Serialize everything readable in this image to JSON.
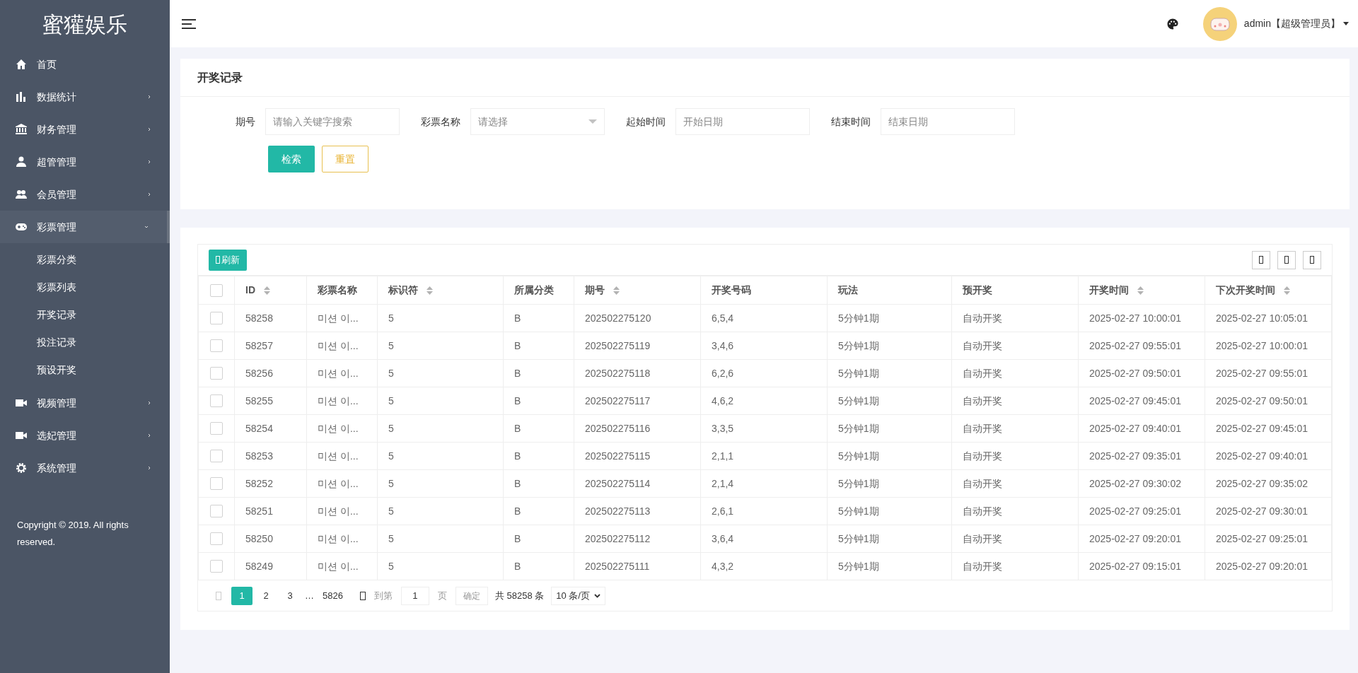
{
  "sidebar": {
    "logo": "蜜獾娱乐",
    "items": [
      {
        "label": "首页",
        "kind": "link",
        "expanded": false
      },
      {
        "label": "数据统计",
        "kind": "menu",
        "expanded": false
      },
      {
        "label": "财务管理",
        "kind": "menu",
        "expanded": false
      },
      {
        "label": "超管管理",
        "kind": "menu",
        "expanded": false
      },
      {
        "label": "会员管理",
        "kind": "menu",
        "expanded": false
      },
      {
        "label": "彩票管理",
        "kind": "menu",
        "expanded": true,
        "children": [
          {
            "label": "彩票分类"
          },
          {
            "label": "彩票列表"
          },
          {
            "label": "开奖记录"
          },
          {
            "label": "投注记录"
          },
          {
            "label": "预设开奖"
          }
        ]
      },
      {
        "label": "视频管理",
        "kind": "menu",
        "expanded": false
      },
      {
        "label": "选妃管理",
        "kind": "menu",
        "expanded": false
      },
      {
        "label": "系统管理",
        "kind": "menu",
        "expanded": false
      }
    ],
    "copyright": "Copyright © 2019. All rights reserved."
  },
  "header": {
    "user": "admin【超级管理员】"
  },
  "filter": {
    "title": "开奖记录",
    "fields": [
      {
        "label": "期号",
        "kind": "text",
        "placeholder": "请输入关键字搜索"
      },
      {
        "label": "彩票名称",
        "kind": "select",
        "placeholder": "请选择"
      },
      {
        "label": "起始时间",
        "kind": "text",
        "placeholder": "开始日期"
      },
      {
        "label": "结束时间",
        "kind": "text",
        "placeholder": "结束日期"
      }
    ],
    "buttons": [
      {
        "label": "检索",
        "kind": "primary"
      },
      {
        "label": "重置",
        "kind": "outline"
      }
    ]
  },
  "table": {
    "refresh": "刷新",
    "select_all_checked": false,
    "columns": [
      {
        "label": "ID",
        "sortable": true
      },
      {
        "label": "彩票名称",
        "sortable": false
      },
      {
        "label": "标识符",
        "sortable": true
      },
      {
        "label": "所属分类",
        "sortable": false
      },
      {
        "label": "期号",
        "sortable": true
      },
      {
        "label": "开奖号码",
        "sortable": false
      },
      {
        "label": "玩法",
        "sortable": false
      },
      {
        "label": "预开奖",
        "sortable": false
      },
      {
        "label": "开奖时间",
        "sortable": true
      },
      {
        "label": "下次开奖时间",
        "sortable": true
      }
    ],
    "rows": [
      {
        "checked": false,
        "cells": [
          "58258",
          "미션 이...",
          "5",
          "B",
          "202502275120",
          "6,5,4",
          "5分钟1期",
          "自动开奖",
          "2025-02-27 10:00:01",
          "2025-02-27 10:05:01"
        ]
      },
      {
        "checked": false,
        "cells": [
          "58257",
          "미션 이...",
          "5",
          "B",
          "202502275119",
          "3,4,6",
          "5分钟1期",
          "自动开奖",
          "2025-02-27 09:55:01",
          "2025-02-27 10:00:01"
        ]
      },
      {
        "checked": false,
        "cells": [
          "58256",
          "미션 이...",
          "5",
          "B",
          "202502275118",
          "6,2,6",
          "5分钟1期",
          "自动开奖",
          "2025-02-27 09:50:01",
          "2025-02-27 09:55:01"
        ]
      },
      {
        "checked": false,
        "cells": [
          "58255",
          "미션 이...",
          "5",
          "B",
          "202502275117",
          "4,6,2",
          "5分钟1期",
          "自动开奖",
          "2025-02-27 09:45:01",
          "2025-02-27 09:50:01"
        ]
      },
      {
        "checked": false,
        "cells": [
          "58254",
          "미션 이...",
          "5",
          "B",
          "202502275116",
          "3,3,5",
          "5分钟1期",
          "自动开奖",
          "2025-02-27 09:40:01",
          "2025-02-27 09:45:01"
        ]
      },
      {
        "checked": false,
        "cells": [
          "58253",
          "미션 이...",
          "5",
          "B",
          "202502275115",
          "2,1,1",
          "5分钟1期",
          "自动开奖",
          "2025-02-27 09:35:01",
          "2025-02-27 09:40:01"
        ]
      },
      {
        "checked": false,
        "cells": [
          "58252",
          "미션 이...",
          "5",
          "B",
          "202502275114",
          "2,1,4",
          "5分钟1期",
          "自动开奖",
          "2025-02-27 09:30:02",
          "2025-02-27 09:35:02"
        ]
      },
      {
        "checked": false,
        "cells": [
          "58251",
          "미션 이...",
          "5",
          "B",
          "202502275113",
          "2,6,1",
          "5分钟1期",
          "自动开奖",
          "2025-02-27 09:25:01",
          "2025-02-27 09:30:01"
        ]
      },
      {
        "checked": false,
        "cells": [
          "58250",
          "미션 이...",
          "5",
          "B",
          "202502275112",
          "3,6,4",
          "5分钟1期",
          "自动开奖",
          "2025-02-27 09:20:01",
          "2025-02-27 09:25:01"
        ]
      },
      {
        "checked": false,
        "cells": [
          "58249",
          "미션 이...",
          "5",
          "B",
          "202502275111",
          "4,3,2",
          "5分钟1期",
          "自动开奖",
          "2025-02-27 09:15:01",
          "2025-02-27 09:20:01"
        ]
      }
    ]
  },
  "pagination": {
    "pages": [
      {
        "label": "1",
        "selected": true
      },
      {
        "label": "2",
        "selected": false
      },
      {
        "label": "3",
        "selected": false
      }
    ],
    "ellipsis": "…",
    "last": "5826",
    "goto_label": "到第",
    "goto_value": "1",
    "page_unit": "页",
    "confirm": "确定",
    "total": "共 58258 条",
    "page_size": "10 条/页"
  }
}
